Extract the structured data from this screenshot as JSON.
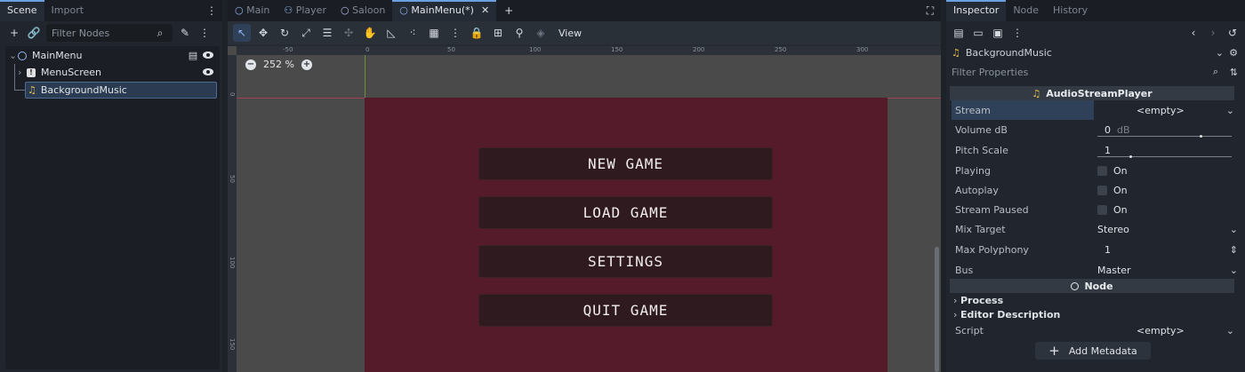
{
  "left": {
    "tabs": [
      "Scene",
      "Import"
    ],
    "filter_placeholder": "Filter Nodes",
    "tree": [
      {
        "label": "MainMenu"
      },
      {
        "label": "MenuScreen"
      },
      {
        "label": "BackgroundMusic"
      }
    ]
  },
  "center": {
    "tabs": [
      "Main",
      "Player",
      "Saloon",
      "MainMenu(*)"
    ],
    "view_label": "View",
    "zoom": "252 %",
    "ruler_h": [
      "-50",
      "0",
      "50",
      "100",
      "150",
      "200",
      "250",
      "300"
    ],
    "ruler_v": [
      "0",
      "50",
      "100",
      "150"
    ],
    "menu_buttons": [
      "NEW GAME",
      "LOAD GAME",
      "SETTINGS",
      "QUIT GAME"
    ]
  },
  "right": {
    "tabs": [
      "Inspector",
      "Node",
      "History"
    ],
    "selected_node": "BackgroundMusic",
    "filter_placeholder": "Filter Properties",
    "section_title": "AudioStreamPlayer",
    "props": {
      "stream_label": "Stream",
      "stream_value": "<empty>",
      "volume_label": "Volume dB",
      "volume_value": "0",
      "volume_unit": "dB",
      "pitch_label": "Pitch Scale",
      "pitch_value": "1",
      "playing_label": "Playing",
      "playing_value": "On",
      "autoplay_label": "Autoplay",
      "autoplay_value": "On",
      "paused_label": "Stream Paused",
      "paused_value": "On",
      "mix_label": "Mix Target",
      "mix_value": "Stereo",
      "poly_label": "Max Polyphony",
      "poly_value": "1",
      "bus_label": "Bus",
      "bus_value": "Master"
    },
    "node_section": "Node",
    "process_label": "Process",
    "editor_desc_label": "Editor Description",
    "script_label": "Script",
    "script_value": "<empty>",
    "add_metadata": "Add Metadata"
  },
  "colors": {
    "accent": "#6c9fe0",
    "game_bg": "#561b2b",
    "button_bg": "#2f1b1f"
  }
}
